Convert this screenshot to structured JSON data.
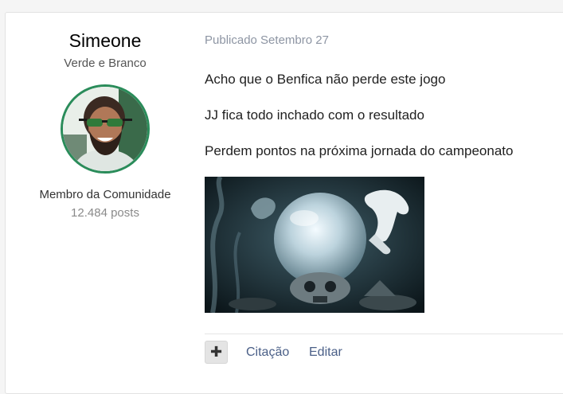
{
  "author": {
    "name": "Simeone",
    "group": "Verde e Branco",
    "rank": "Membro da Comunidade",
    "posts": "12.484 posts",
    "avatar_border_color": "#2a8c5a"
  },
  "post": {
    "meta": "Publicado Setembro 27",
    "lines": [
      "Acho que o Benfica não perde este jogo",
      "JJ fica todo inchado com o resultado",
      "Perdem pontos na próxima jornada do campeonato"
    ],
    "image_icon": "crystal-ball-gif"
  },
  "actions": {
    "plus_icon": "plus-icon",
    "plus_label": "✚",
    "quote_label": "Citação",
    "edit_label": "Editar",
    "link_color": "#4a5f87"
  }
}
